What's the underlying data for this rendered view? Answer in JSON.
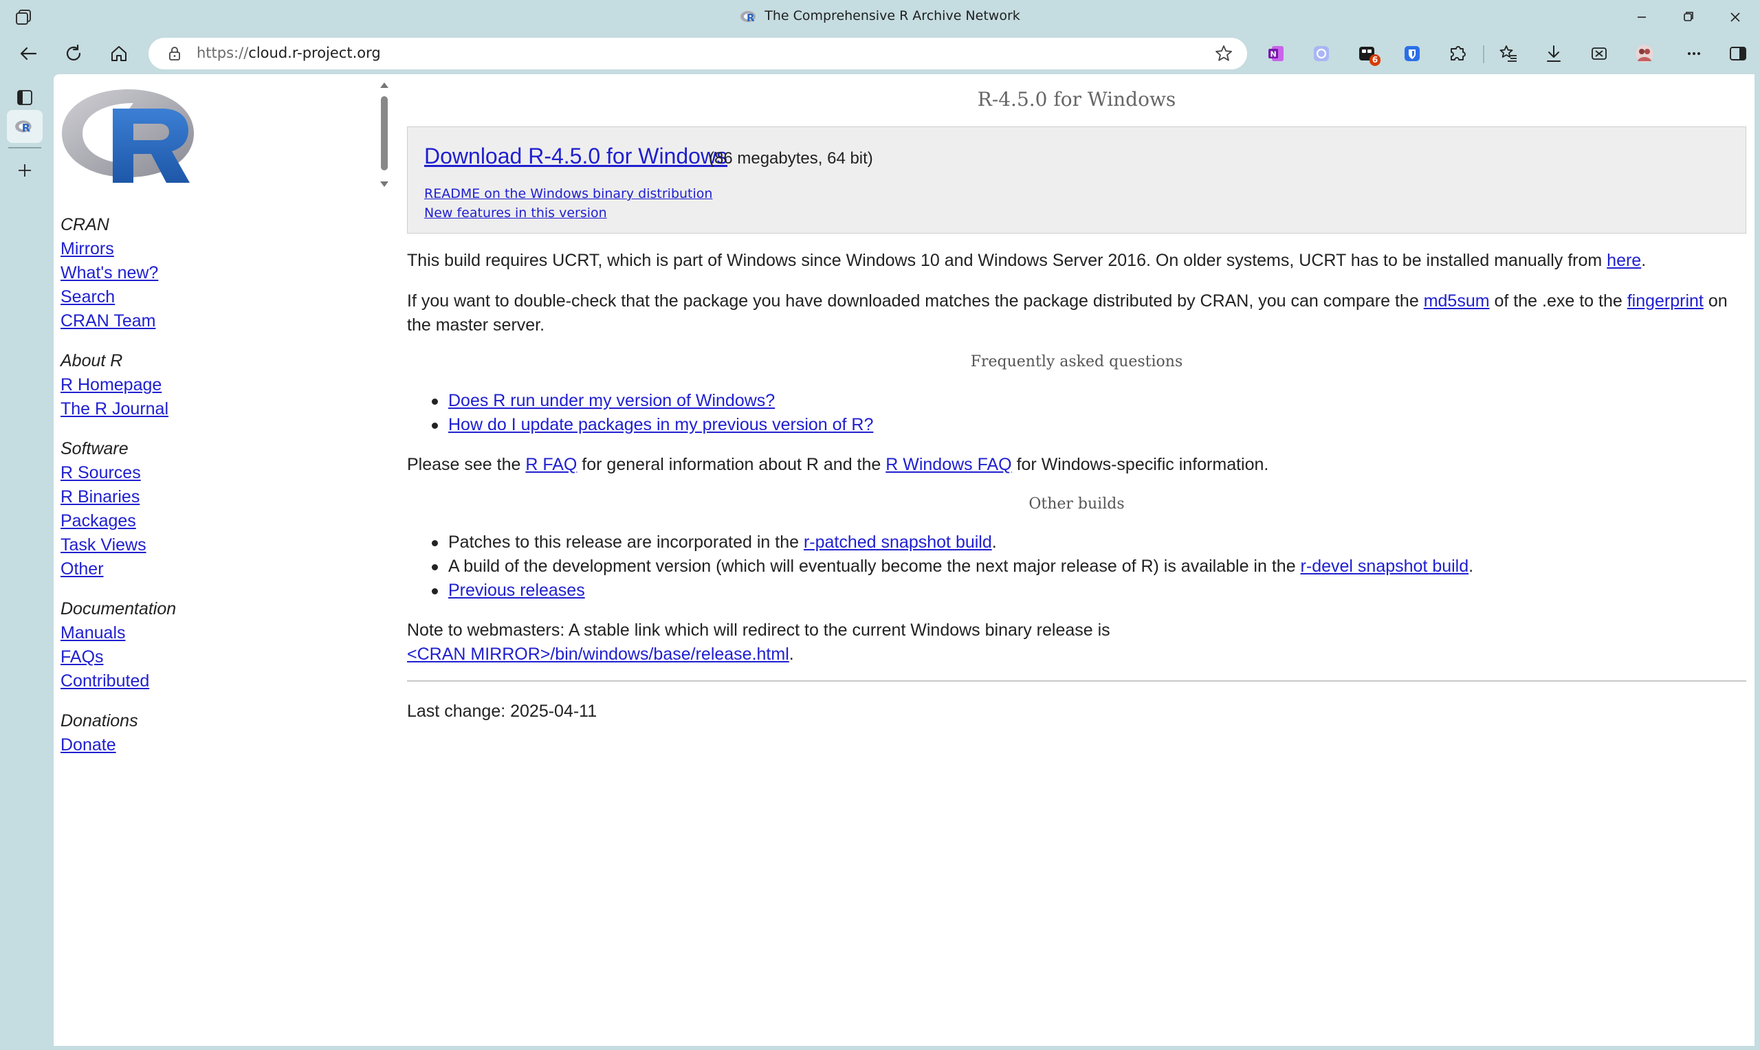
{
  "window": {
    "title": "The Comprehensive R Archive Network"
  },
  "browser": {
    "url_protocol": "https://",
    "url_host": "cloud.r-project.org",
    "extension_badge": "6"
  },
  "sidebar": {
    "groups": [
      {
        "heading": "CRAN",
        "links": [
          "Mirrors",
          "What's new?",
          "Search",
          "CRAN Team"
        ]
      },
      {
        "heading": "About R",
        "links": [
          "R Homepage",
          "The R Journal"
        ]
      },
      {
        "heading": "Software",
        "links": [
          "R Sources",
          "R Binaries",
          "Packages",
          "Task Views",
          "Other"
        ]
      },
      {
        "heading": "Documentation",
        "links": [
          "Manuals",
          "FAQs",
          "Contributed"
        ]
      },
      {
        "heading": "Donations",
        "links": [
          "Donate"
        ]
      }
    ]
  },
  "main": {
    "title": "R-4.5.0 for Windows",
    "download": {
      "link": "Download R-4.5.0 for Windows",
      "size": "(86 megabytes, 64 bit)",
      "readme": "README on the Windows binary distribution",
      "news": "New features in this version"
    },
    "ucrt": {
      "text": "This build requires UCRT, which is part of Windows since Windows 10 and Windows Server 2016. On older systems, UCRT has to be installed manually from ",
      "link": "here",
      "end": "."
    },
    "checksum": {
      "text1": "If you want to double-check that the package you have downloaded matches the package distributed by CRAN, you can compare the ",
      "link1": "md5sum",
      "text2": " of the .exe to the ",
      "link2": "fingerprint",
      "text3": " on the master server."
    },
    "faq_heading": "Frequently asked questions",
    "faq_items": [
      "Does R run under my version of Windows?",
      "How do I update packages in my previous version of R?"
    ],
    "faq_note": {
      "text1": "Please see the ",
      "link1": "R FAQ",
      "text2": " for general information about R and the ",
      "link2": "R Windows FAQ",
      "text3": " for Windows-specific information."
    },
    "other_heading": "Other builds",
    "other_items": {
      "patched_text": "Patches to this release are incorporated in the ",
      "patched_link": "r-patched snapshot build",
      "patched_end": ".",
      "devel_text": "A build of the development version (which will eventually become the next major release of R) is available in the ",
      "devel_link": "r-devel snapshot build",
      "devel_end": ".",
      "previous": "Previous releases"
    },
    "webmasters": {
      "text": "Note to webmasters: A stable link which will redirect to the current Windows binary release is",
      "link": "<CRAN MIRROR>/bin/windows/base/release.html",
      "end": "."
    },
    "last_change": "Last change: 2025-04-11"
  }
}
